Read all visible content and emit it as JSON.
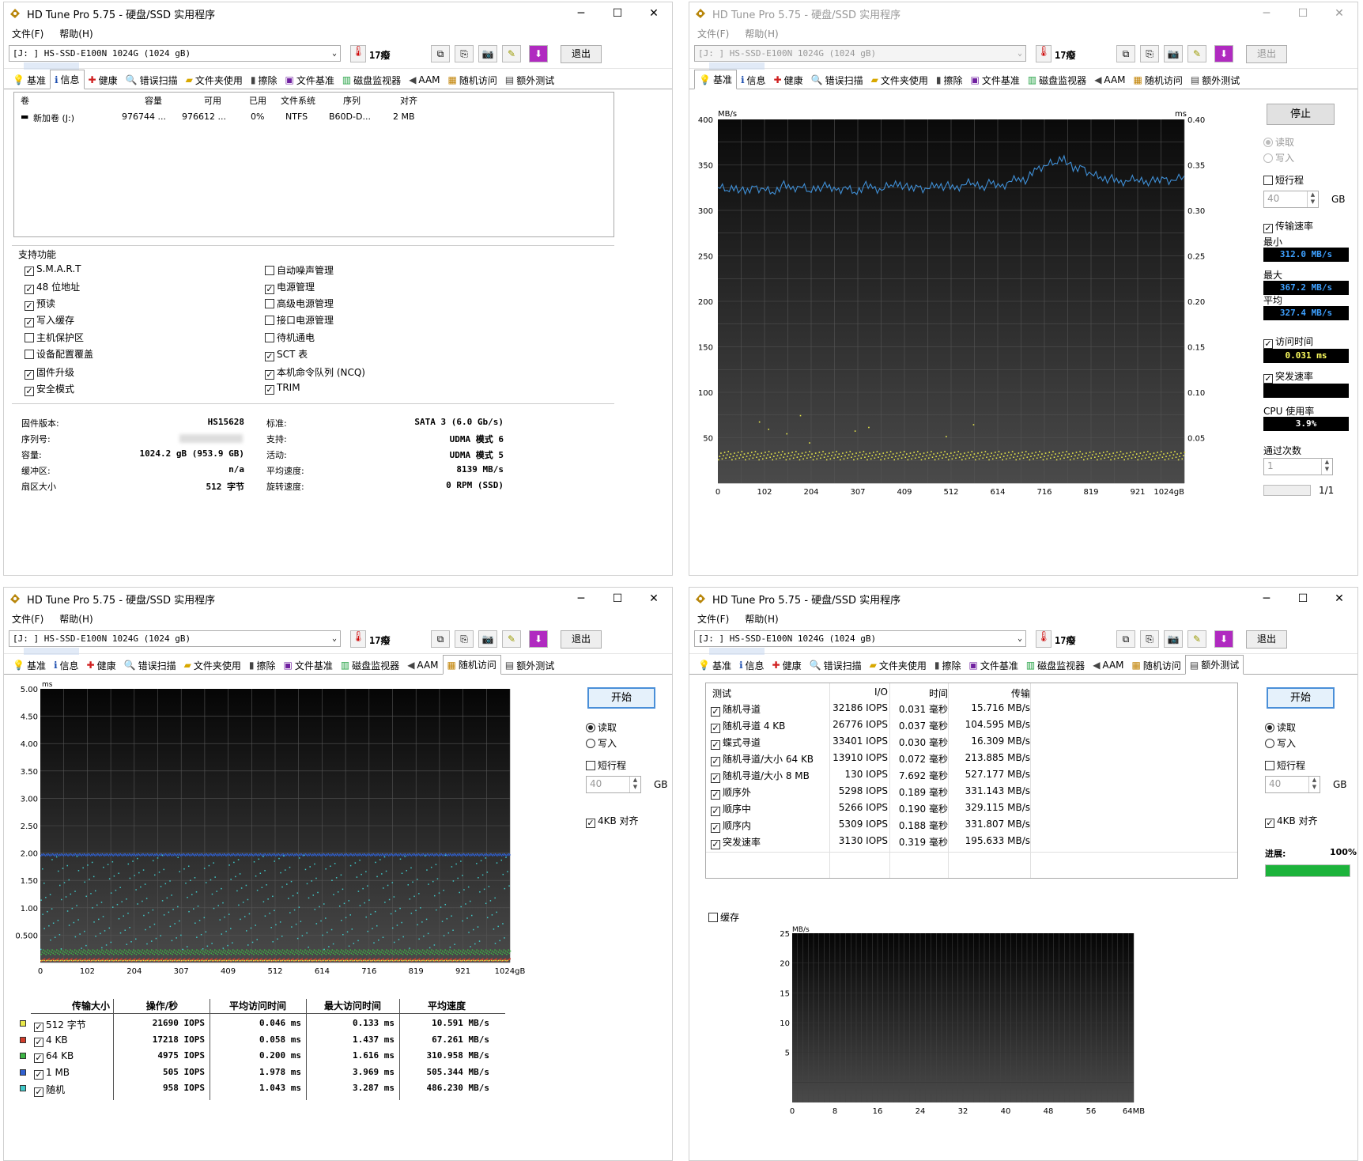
{
  "app": {
    "title": "HD Tune Pro 5.75 - 硬盘/SSD 实用程序",
    "min": "─",
    "max": "☐",
    "close": "✕"
  },
  "menu": {
    "file": "文件(F)",
    "help": "帮助(H)"
  },
  "toolbar": {
    "drive": "[J: ] HS-SSD-E100N 1024G (1024 gB)",
    "temp": "17癈",
    "exit": "退出"
  },
  "tabs": [
    {
      "icon": "lightbulb-icon",
      "label": "基准"
    },
    {
      "icon": "info-icon",
      "label": "信息"
    },
    {
      "icon": "health-cross-icon",
      "label": "健康"
    },
    {
      "icon": "magnifier-icon",
      "label": "错误扫描"
    },
    {
      "icon": "folder-icon",
      "label": "文件夹使用"
    },
    {
      "icon": "trash-icon",
      "label": "擦除"
    },
    {
      "icon": "file-benchmark-icon",
      "label": "文件基准"
    },
    {
      "icon": "disk-monitor-icon",
      "label": "磁盘监视器"
    },
    {
      "icon": "speaker-icon",
      "label": "AAM"
    },
    {
      "icon": "random-access-icon",
      "label": "随机访问"
    },
    {
      "icon": "extra-tests-icon",
      "label": "额外测试"
    }
  ],
  "info": {
    "cols": [
      "卷",
      "容量",
      "可用",
      "已用",
      "文件系统",
      "序列",
      "对齐"
    ],
    "row": [
      "新加卷 (J:)",
      "976744 ...",
      "976612 ...",
      "0%",
      "NTFS",
      "B60D-D...",
      "2 MB"
    ],
    "features_title": "支持功能",
    "features_left": [
      {
        "label": "S.M.A.R.T",
        "checked": true
      },
      {
        "label": "48 位地址",
        "checked": true
      },
      {
        "label": "预读",
        "checked": true
      },
      {
        "label": "写入缓存",
        "checked": true
      },
      {
        "label": "主机保护区",
        "checked": false
      },
      {
        "label": "设备配置覆盖",
        "checked": false
      },
      {
        "label": "固件升级",
        "checked": true
      },
      {
        "label": "安全模式",
        "checked": true
      }
    ],
    "features_right": [
      {
        "label": "自动噪声管理",
        "checked": false
      },
      {
        "label": "电源管理",
        "checked": true
      },
      {
        "label": "高级电源管理",
        "checked": false
      },
      {
        "label": "接口电源管理",
        "checked": false
      },
      {
        "label": "待机通电",
        "checked": false
      },
      {
        "label": "SCT 表",
        "checked": true
      },
      {
        "label": "本机命令队列 (NCQ)",
        "checked": true
      },
      {
        "label": "TRIM",
        "checked": true
      }
    ],
    "details_left": [
      {
        "k": "固件版本:",
        "v": "HS15628"
      },
      {
        "k": "序列号:",
        "v": ""
      },
      {
        "k": "容量:",
        "v": "1024.2 gB (953.9 GB)"
      },
      {
        "k": "缓冲区:",
        "v": "n/a"
      },
      {
        "k": "扇区大小",
        "v": "512 字节"
      }
    ],
    "details_right": [
      {
        "k": "标准:",
        "v": "SATA 3 (6.0 Gb/s)"
      },
      {
        "k": "支持:",
        "v": "UDMA 模式 6"
      },
      {
        "k": "活动:",
        "v": "UDMA 模式 5"
      },
      {
        "k": "平均速度:",
        "v": "8139 MB/s"
      },
      {
        "k": "旋转速度:",
        "v": "0 RPM (SSD)"
      }
    ]
  },
  "bench": {
    "stop": "停止",
    "read": "读取",
    "write": "写入",
    "short_stroke": "短行程",
    "stroke_val": "40",
    "gb": "GB",
    "transfer_rate": "传输速率",
    "min_label": "最小",
    "min": "312.0 MB/s",
    "max_label": "最大",
    "max": "367.2 MB/s",
    "avg_label": "平均",
    "avg": "327.4 MB/s",
    "access_time": "访问时间",
    "access": "0.031 ms",
    "burst": "突发速率",
    "cpu_label": "CPU 使用率",
    "cpu": "3.9%",
    "passes": "通过次数",
    "passes_val": "1",
    "pass_count": "1/1",
    "chart_data": {
      "type": "line",
      "xlabel": "",
      "y_unit": "MB/s",
      "y2_unit": "ms",
      "ylim": [
        0,
        400
      ],
      "y2lim": [
        0,
        0.4
      ],
      "yticks": [
        50,
        100,
        150,
        200,
        250,
        300,
        350,
        400
      ],
      "y2ticks": [
        0.05,
        0.1,
        0.15,
        0.2,
        0.25,
        0.3,
        0.35,
        0.4
      ],
      "xticks": [
        "0",
        "102",
        "204",
        "307",
        "409",
        "512",
        "614",
        "716",
        "819",
        "921",
        "1024gB"
      ],
      "series": [
        {
          "name": "传输速率",
          "color": "#3f8fd6",
          "x": [
            0,
            20,
            40,
            60,
            80,
            100,
            120,
            140,
            160,
            180,
            200,
            220,
            240,
            260,
            280,
            300,
            320,
            340,
            360,
            380,
            400,
            420,
            440,
            460,
            480,
            500,
            520,
            540,
            560,
            580,
            600,
            620,
            640,
            660,
            680,
            700,
            720,
            740,
            760,
            780,
            800,
            820,
            840,
            860,
            880,
            900,
            920,
            940,
            960,
            980,
            1000,
            1024
          ],
          "y": [
            325,
            322,
            327,
            318,
            326,
            324,
            320,
            328,
            323,
            326,
            321,
            327,
            325,
            322,
            326,
            320,
            327,
            324,
            322,
            328,
            331,
            322,
            326,
            324,
            329,
            327,
            323,
            328,
            330,
            327,
            329,
            326,
            332,
            336,
            334,
            345,
            349,
            352,
            360,
            343,
            348,
            340,
            337,
            335,
            330,
            332,
            334,
            333,
            331,
            335,
            333,
            338
          ]
        },
        {
          "name": "访问时间",
          "color": "#e8e84a",
          "scatter": true,
          "y2_level": 0.031
        }
      ]
    }
  },
  "random": {
    "start": "开始",
    "read": "读取",
    "write": "写入",
    "short_stroke": "短行程",
    "stroke_val": "40",
    "gb": "GB",
    "align": "4KB 对齐",
    "chart_data": {
      "type": "scatter",
      "y_unit": "ms",
      "ylim": [
        0,
        5
      ],
      "yticks": [
        "5.00",
        "4.50",
        "4.00",
        "3.50",
        "3.00",
        "2.50",
        "2.00",
        "1.50",
        "1.00",
        "0.500"
      ],
      "xticks": [
        "0",
        "102",
        "204",
        "307",
        "409",
        "512",
        "614",
        "716",
        "819",
        "921",
        "1024gB"
      ],
      "series": [
        {
          "name": "512 字节",
          "color": "#e8e84a",
          "level": 0.046
        },
        {
          "name": "4 KB",
          "color": "#d23b2a",
          "level": 0.058
        },
        {
          "name": "64 KB",
          "color": "#3cb544",
          "level": 0.2
        },
        {
          "name": "1 MB",
          "color": "#3060d0",
          "level": 1.978
        },
        {
          "name": "随机",
          "color": "#40c8c8",
          "level": 1.043
        }
      ]
    },
    "headers": [
      "传输大小",
      "操作/秒",
      "平均访问时间",
      "最大访问时间",
      "平均速度"
    ],
    "rows": [
      {
        "color": "#e8e84a",
        "label": "512 字节",
        "ops": "21690 IOPS",
        "avg": "0.046 ms",
        "max": "0.133 ms",
        "speed": "10.591 MB/s"
      },
      {
        "color": "#d23b2a",
        "label": "4 KB",
        "ops": "17218 IOPS",
        "avg": "0.058 ms",
        "max": "1.437 ms",
        "speed": "67.261 MB/s"
      },
      {
        "color": "#3cb544",
        "label": "64 KB",
        "ops": "4975 IOPS",
        "avg": "0.200 ms",
        "max": "1.616 ms",
        "speed": "310.958 MB/s"
      },
      {
        "color": "#3060d0",
        "label": "1 MB",
        "ops": "505 IOPS",
        "avg": "1.978 ms",
        "max": "3.969 ms",
        "speed": "505.344 MB/s"
      },
      {
        "color": "#40c8c8",
        "label": "随机",
        "ops": "958 IOPS",
        "avg": "1.043 ms",
        "max": "3.287 ms",
        "speed": "486.230 MB/s"
      }
    ]
  },
  "extra": {
    "start": "开始",
    "read": "读取",
    "write": "写入",
    "short_stroke": "短行程",
    "stroke_val": "40",
    "gb": "GB",
    "align": "4KB 对齐",
    "progress_label": "进展:",
    "progress": "100%",
    "progress_fraction": 1.0,
    "cache": "缓存",
    "headers": [
      "测试",
      "I/O",
      "时间",
      "传输"
    ],
    "rows": [
      {
        "name": "随机寻道",
        "io": "32186 IOPS",
        "time": "0.031 毫秒",
        "tr": "15.716 MB/s"
      },
      {
        "name": "随机寻道 4 KB",
        "io": "26776 IOPS",
        "time": "0.037 毫秒",
        "tr": "104.595 MB/s"
      },
      {
        "name": "蝶式寻道",
        "io": "33401 IOPS",
        "time": "0.030 毫秒",
        "tr": "16.309 MB/s"
      },
      {
        "name": "随机寻道/大小 64 KB",
        "io": "13910 IOPS",
        "time": "0.072 毫秒",
        "tr": "213.885 MB/s"
      },
      {
        "name": "随机寻道/大小 8 MB",
        "io": "130 IOPS",
        "time": "7.692 毫秒",
        "tr": "527.177 MB/s"
      },
      {
        "name": "顺序外",
        "io": "5298 IOPS",
        "time": "0.189 毫秒",
        "tr": "331.143 MB/s"
      },
      {
        "name": "顺序中",
        "io": "5266 IOPS",
        "time": "0.190 毫秒",
        "tr": "329.115 MB/s"
      },
      {
        "name": "顺序内",
        "io": "5309 IOPS",
        "time": "0.188 毫秒",
        "tr": "331.807 MB/s"
      },
      {
        "name": "突发速率",
        "io": "3130 IOPS",
        "time": "0.319 毫秒",
        "tr": "195.633 MB/s"
      }
    ],
    "chart_data": {
      "type": "bar",
      "y_unit": "MB/s",
      "ylim": [
        0,
        25
      ],
      "yticks": [
        "25",
        "20",
        "15",
        "10",
        "5"
      ],
      "xticks": [
        "0",
        "8",
        "16",
        "24",
        "32",
        "40",
        "48",
        "56",
        "64MB"
      ],
      "values": []
    }
  }
}
